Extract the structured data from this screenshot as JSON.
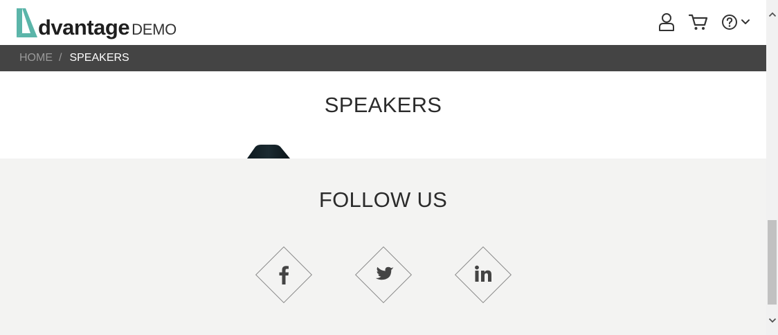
{
  "header": {
    "logo_name": "dvantage",
    "logo_suffix": "DEMO",
    "user_icon": "user-icon",
    "cart_icon": "cart-icon",
    "help_icon": "help-icon",
    "help_dropdown_icon": "chevron-down-icon"
  },
  "breadcrumb": {
    "home": "HOME",
    "separator": "/",
    "current": "SPEAKERS"
  },
  "main": {
    "title": "SPEAKERS"
  },
  "footer": {
    "title": "FOLLOW US",
    "social": [
      {
        "name": "facebook-icon"
      },
      {
        "name": "twitter-icon"
      },
      {
        "name": "linkedin-icon"
      }
    ]
  },
  "colors": {
    "brand_teal": "#5bb5a9",
    "breadcrumb_bar": "#444444",
    "footer_bg": "#f3f3f2",
    "text_dark": "#2b2b2b"
  }
}
